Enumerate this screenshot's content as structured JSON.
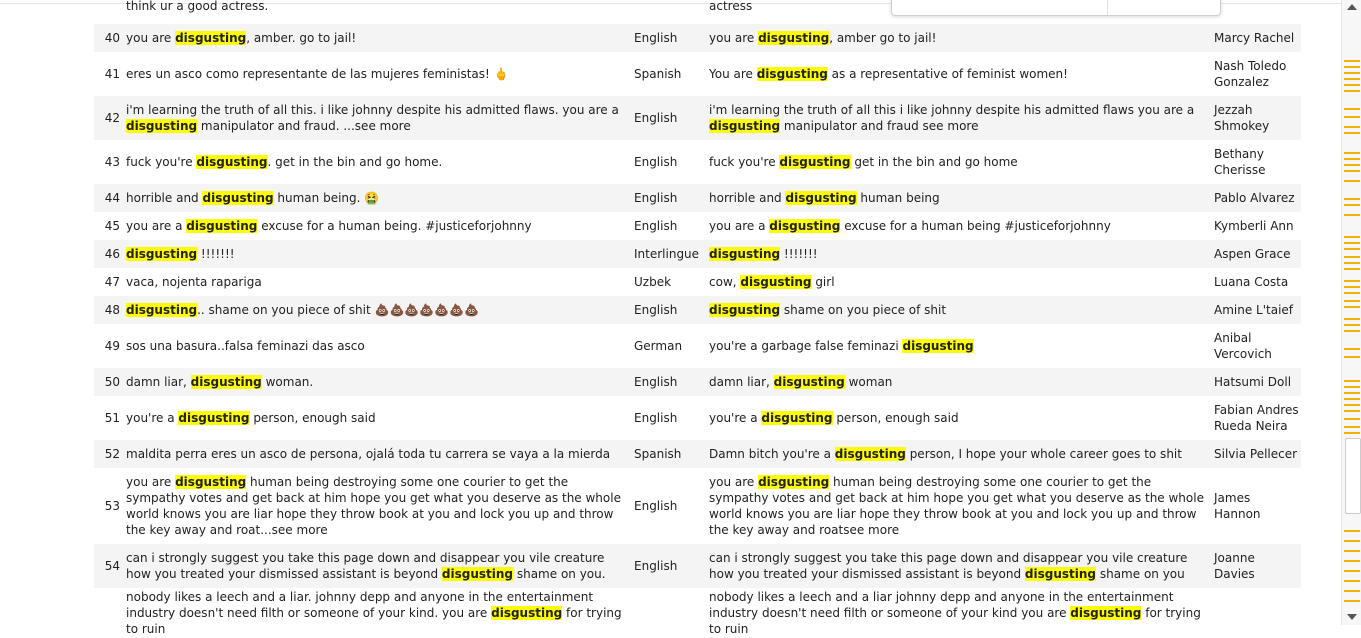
{
  "rows": [
    {
      "num": "",
      "orig": [
        {
          "t": "think ur a good actress."
        }
      ],
      "lang": "",
      "trans": [
        {
          "t": "actress"
        }
      ],
      "name": ""
    },
    {
      "num": "40",
      "orig": [
        {
          "t": "you are "
        },
        {
          "t": "disgusting",
          "h": 1
        },
        {
          "t": ", amber. go to jail!"
        }
      ],
      "lang": "English",
      "trans": [
        {
          "t": "you are "
        },
        {
          "t": "disgusting",
          "h": 1
        },
        {
          "t": ", amber go to jail!"
        }
      ],
      "name": "Marcy Rachel"
    },
    {
      "num": "41",
      "orig": [
        {
          "t": "eres un asco como representante de las mujeres feministas! "
        },
        {
          "t": "🖕",
          "e": 1
        }
      ],
      "lang": "Spanish",
      "trans": [
        {
          "t": "You are "
        },
        {
          "t": "disgusting",
          "h": 1
        },
        {
          "t": " as a representative of feminist women!"
        }
      ],
      "name": "Nash Toledo Gonzalez"
    },
    {
      "num": "42",
      "orig": [
        {
          "t": "i'm learning the truth of all this. i like johnny despite his admitted flaws. you are a "
        },
        {
          "t": "disgusting",
          "h": 1
        },
        {
          "t": " manipulator and fraud. ...see more"
        }
      ],
      "lang": "English",
      "trans": [
        {
          "t": "i'm learning the truth of all this i like johnny despite his admitted flaws you are a "
        },
        {
          "t": "disgusting",
          "h": 1
        },
        {
          "t": " manipulator and fraud see more"
        }
      ],
      "name": "Jezzah Shmokey"
    },
    {
      "num": "43",
      "orig": [
        {
          "t": "fuck you're "
        },
        {
          "t": "disgusting",
          "h": 1
        },
        {
          "t": ". get in the bin and go home."
        }
      ],
      "lang": "English",
      "trans": [
        {
          "t": "fuck you're "
        },
        {
          "t": "disgusting",
          "h": 1
        },
        {
          "t": " get in the bin and go home"
        }
      ],
      "name": "Bethany Cherisse"
    },
    {
      "num": "44",
      "orig": [
        {
          "t": "horrible and "
        },
        {
          "t": "disgusting",
          "h": 1
        },
        {
          "t": " human being. "
        },
        {
          "t": "🤮",
          "e": 1
        }
      ],
      "lang": "English",
      "trans": [
        {
          "t": "horrible and "
        },
        {
          "t": "disgusting",
          "h": 1
        },
        {
          "t": " human being"
        }
      ],
      "name": "Pablo Alvarez"
    },
    {
      "num": "45",
      "orig": [
        {
          "t": "you are a "
        },
        {
          "t": "disgusting",
          "h": 1
        },
        {
          "t": " excuse for a human being. #justiceforjohnny"
        }
      ],
      "lang": "English",
      "trans": [
        {
          "t": "you are a "
        },
        {
          "t": "disgusting",
          "h": 1
        },
        {
          "t": " excuse for a human being #justiceforjohnny"
        }
      ],
      "name": "Kymberli Ann"
    },
    {
      "num": "46",
      "orig": [
        {
          "t": "disgusting",
          "h": 1
        },
        {
          "t": " !!!!!!!"
        }
      ],
      "lang": "Interlingue",
      "trans": [
        {
          "t": "disgusting",
          "h": 1
        },
        {
          "t": " !!!!!!!"
        }
      ],
      "name": "Aspen Grace"
    },
    {
      "num": "47",
      "orig": [
        {
          "t": "vaca, nojenta rapariga"
        }
      ],
      "lang": "Uzbek",
      "trans": [
        {
          "t": "cow, "
        },
        {
          "t": "disgusting",
          "h": 1
        },
        {
          "t": " girl"
        }
      ],
      "name": "Luana Costa"
    },
    {
      "num": "48",
      "orig": [
        {
          "t": "disgusting",
          "h": 1
        },
        {
          "t": ".. shame on you piece of shit "
        },
        {
          "t": "💩💩💩💩💩💩💩",
          "e": 1
        }
      ],
      "lang": "English",
      "trans": [
        {
          "t": "disgusting",
          "h": 1
        },
        {
          "t": " shame on you piece of shit"
        }
      ],
      "name": "Amine L'taief"
    },
    {
      "num": "49",
      "orig": [
        {
          "t": "sos una basura..falsa feminazi das asco"
        }
      ],
      "lang": "German",
      "trans": [
        {
          "t": "you're a garbage false feminazi "
        },
        {
          "t": "disgusting",
          "h": 1
        }
      ],
      "name": "Anibal Vercovich"
    },
    {
      "num": "50",
      "orig": [
        {
          "t": "damn liar, "
        },
        {
          "t": "disgusting",
          "h": 1
        },
        {
          "t": " woman."
        }
      ],
      "lang": "English",
      "trans": [
        {
          "t": "damn liar, "
        },
        {
          "t": "disgusting",
          "h": 1
        },
        {
          "t": " woman"
        }
      ],
      "name": "Hatsumi Doll"
    },
    {
      "num": "51",
      "orig": [
        {
          "t": "you're a "
        },
        {
          "t": "disgusting",
          "h": 1
        },
        {
          "t": " person, enough said"
        }
      ],
      "lang": "English",
      "trans": [
        {
          "t": "you're a "
        },
        {
          "t": "disgusting",
          "h": 1
        },
        {
          "t": " person, enough said"
        }
      ],
      "name": "Fabian Andres Rueda Neira"
    },
    {
      "num": "52",
      "orig": [
        {
          "t": "maldita perra eres un asco de persona, ojalá toda tu carrera se vaya a la mierda"
        }
      ],
      "lang": "Spanish",
      "trans": [
        {
          "t": "Damn bitch you're a "
        },
        {
          "t": "disgusting",
          "h": 1
        },
        {
          "t": " person, I hope your whole career goes to shit"
        }
      ],
      "name": "Silvia Pellecer"
    },
    {
      "num": "53",
      "orig": [
        {
          "t": "you are "
        },
        {
          "t": "disgusting",
          "h": 1
        },
        {
          "t": " human being destroying some one courier to get the sympathy votes and get back at him hope you get what you deserve as the whole world knows you are liar hope they throw book at you and lock you up and throw the key away and roat...see more"
        }
      ],
      "lang": "English",
      "trans": [
        {
          "t": "you are "
        },
        {
          "t": "disgusting",
          "h": 1
        },
        {
          "t": " human being destroying some one courier to get the sympathy votes and get back at him hope you get what you deserve as the whole world knows you are liar hope they throw book at you and lock you up and throw the key away and roatsee more"
        }
      ],
      "name": "James Hannon"
    },
    {
      "num": "54",
      "orig": [
        {
          "t": "can i strongly suggest you take this page down and disappear you vile creature how you treated your dismissed assistant is beyond "
        },
        {
          "t": "disgusting",
          "h": 1
        },
        {
          "t": " shame on you."
        }
      ],
      "lang": "English",
      "trans": [
        {
          "t": "can i strongly suggest you take this page down and disappear you vile creature how you treated your dismissed assistant is beyond "
        },
        {
          "t": "disgusting",
          "h": 1
        },
        {
          "t": " shame on you"
        }
      ],
      "name": "Joanne Davies"
    },
    {
      "num": "",
      "orig": [
        {
          "t": "nobody likes a leech and a liar. johnny depp and anyone in the entertainment industry doesn't need filth or someone of your kind. you are "
        },
        {
          "t": "disgusting",
          "h": 1
        },
        {
          "t": " for trying to ruin"
        }
      ],
      "lang": "",
      "trans": [
        {
          "t": "nobody likes a leech and a liar johnny depp and anyone in the entertainment industry doesn't need filth or someone of your kind you are "
        },
        {
          "t": "disgusting",
          "h": 1
        },
        {
          "t": " for trying to ruin"
        }
      ],
      "name": ""
    }
  ]
}
